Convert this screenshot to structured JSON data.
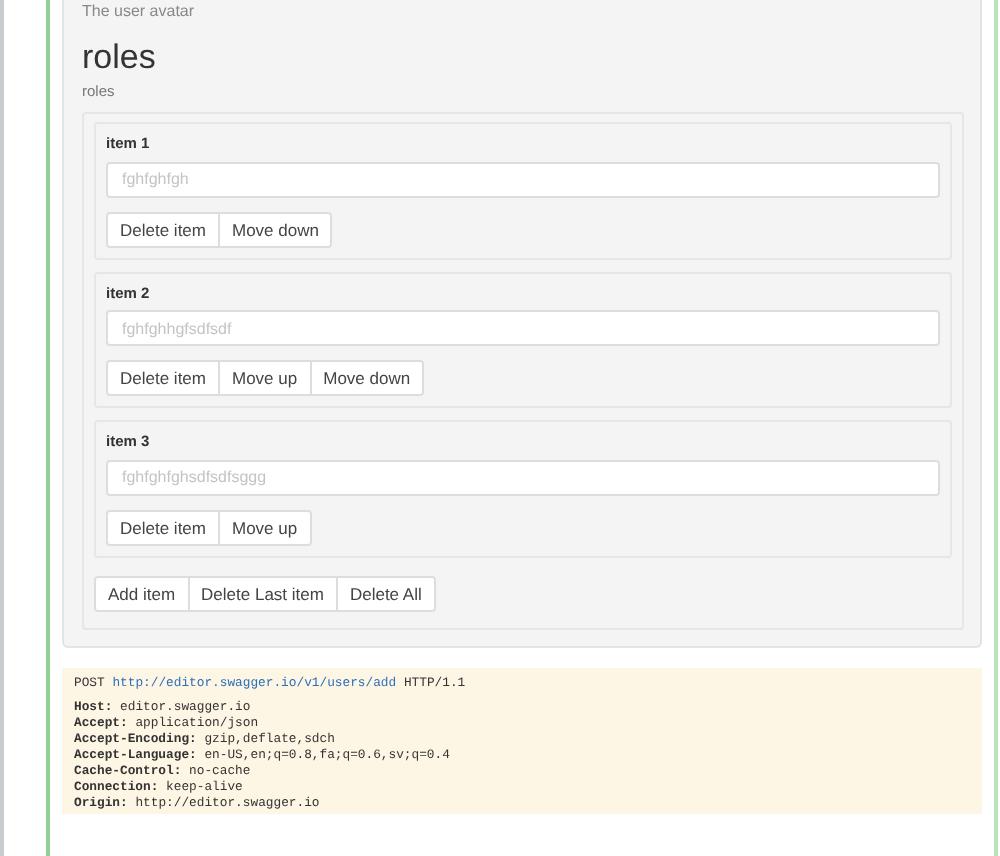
{
  "avatar_help": "The user avatar",
  "roles": {
    "title": "roles",
    "description": "roles",
    "items": [
      {
        "label": "item 1",
        "placeholder": "fghfghfgh",
        "buttons": [
          "Delete item",
          "Move down"
        ]
      },
      {
        "label": "item 2",
        "placeholder": "fghfghhgfsdfsdf",
        "buttons": [
          "Delete item",
          "Move up",
          "Move down"
        ]
      },
      {
        "label": "item 3",
        "placeholder": "fghfghfghsdfsdfsggg",
        "buttons": [
          "Delete item",
          "Move up"
        ]
      }
    ],
    "actions": [
      "Add item",
      "Delete Last item",
      "Delete All"
    ]
  },
  "request": {
    "method": "POST",
    "url": "http://editor.swagger.io/v1/users/add",
    "version": "HTTP/1.1",
    "headers": [
      {
        "name": "Host:",
        "value": "editor.swagger.io"
      },
      {
        "name": "Accept:",
        "value": "application/json"
      },
      {
        "name": "Accept-Encoding:",
        "value": "gzip,deflate,sdch"
      },
      {
        "name": "Accept-Language:",
        "value": "en-US,en;q=0.8,fa;q=0.6,sv;q=0.4"
      },
      {
        "name": "Cache-Control:",
        "value": "no-cache"
      },
      {
        "name": "Connection:",
        "value": "keep-alive"
      },
      {
        "name": "Origin:",
        "value": "http://editor.swagger.io"
      }
    ]
  }
}
